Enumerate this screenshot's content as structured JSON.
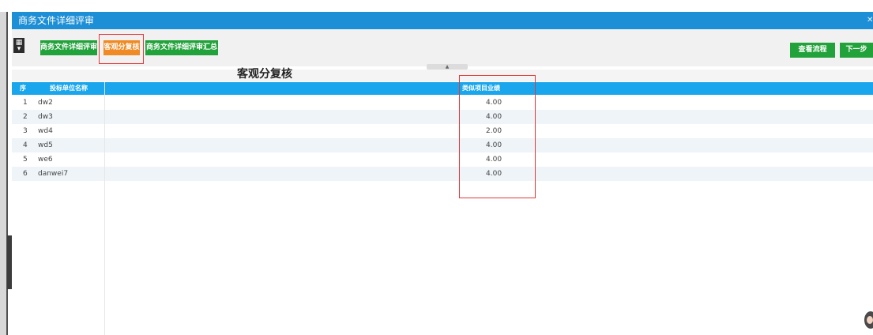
{
  "window": {
    "title": "商务文件详细评审"
  },
  "toolbar": {
    "tabs": [
      {
        "label": "商务文件详细评审"
      },
      {
        "label": "客观分复核"
      },
      {
        "label": "商务文件详细评审汇总"
      }
    ],
    "view_flow_label": "查看流程",
    "next_step_label": "下一步"
  },
  "section": {
    "title": "客观分复核"
  },
  "table": {
    "columns": [
      "序",
      "投标单位名称",
      "类似项目业绩"
    ],
    "rows": [
      {
        "index": "1",
        "name": "dw2",
        "score": "4.00"
      },
      {
        "index": "2",
        "name": "dw3",
        "score": "4.00"
      },
      {
        "index": "3",
        "name": "wd4",
        "score": "2.00"
      },
      {
        "index": "4",
        "name": "wd5",
        "score": "4.00"
      },
      {
        "index": "5",
        "name": "we6",
        "score": "4.00"
      },
      {
        "index": "6",
        "name": "danwei7",
        "score": "4.00"
      }
    ]
  },
  "colors": {
    "title_bar": "#1d8fd6",
    "tab_green": "#22a23a",
    "tab_active": "#f08a24",
    "table_header": "#1aa6ec",
    "highlight": "#e23a3a"
  }
}
